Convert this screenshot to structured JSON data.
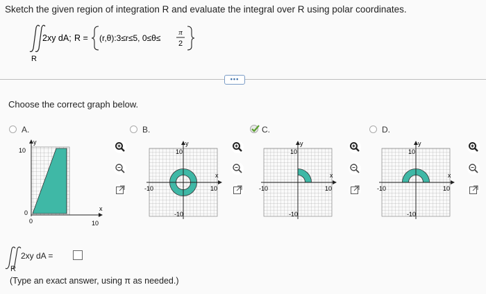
{
  "instruction": "Sketch the given region of integration R and evaluate the integral over R using polar coordinates.",
  "problem": {
    "integrand": "2xy dA;",
    "region_prefix": "R =",
    "region_set": "(r,θ):3≤r≤5, 0≤θ≤",
    "pi": "π",
    "two": "2",
    "sub_R": "R"
  },
  "more_button": "•••",
  "prompt": "Choose the correct graph below.",
  "options": [
    {
      "letter": "A.",
      "selected": false,
      "y_tick": "10",
      "y_zero": "0",
      "x_zero": "0",
      "x_tick": "10",
      "x_axis": "x",
      "y_axis": "y"
    },
    {
      "letter": "B.",
      "selected": false,
      "top_tick": "10",
      "left_tick": "-10",
      "right_tick": "10",
      "bottom_tick": "-10",
      "x_axis": "x",
      "y_axis": "y"
    },
    {
      "letter": "C.",
      "selected": true,
      "top_tick": "10",
      "left_tick": "-10",
      "right_tick": "10",
      "bottom_tick": "-10",
      "x_axis": "x",
      "y_axis": "y"
    },
    {
      "letter": "D.",
      "selected": false,
      "top_tick": "10",
      "left_tick": "-10",
      "right_tick": "10",
      "bottom_tick": "-10",
      "x_axis": "x",
      "y_axis": "y"
    }
  ],
  "answer": {
    "integrand": "2xy dA =",
    "sub_R": "R"
  },
  "note": "(Type an exact answer, using π as needed.)",
  "colors": {
    "region_fill": "#3fb8a6",
    "check": "#5a9e2f",
    "grid": "#9a9a9a"
  }
}
